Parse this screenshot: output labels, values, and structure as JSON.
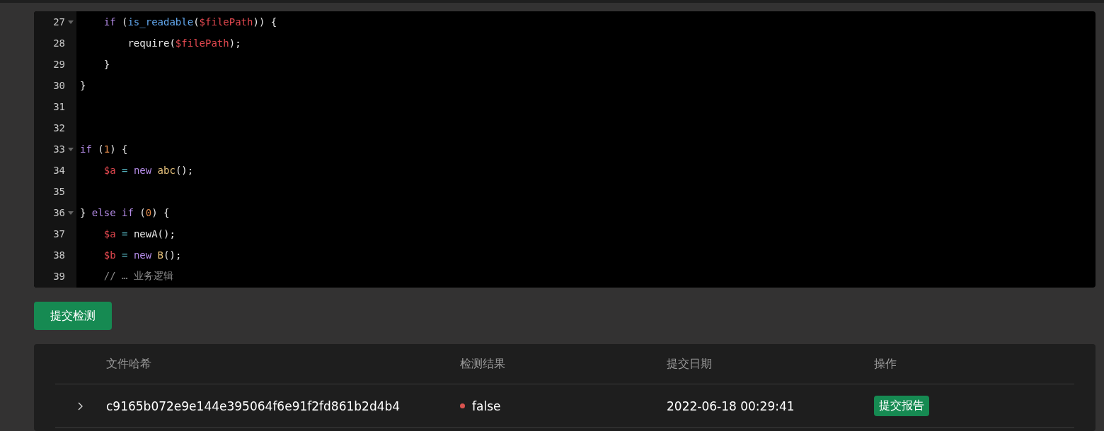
{
  "editor": {
    "lines": [
      {
        "number": "27",
        "foldable": true,
        "tokens": [
          {
            "kind": "keyword",
            "text": "    if"
          },
          {
            "kind": "plain",
            "text": " ("
          },
          {
            "kind": "function",
            "text": "is_readable"
          },
          {
            "kind": "plain",
            "text": "("
          },
          {
            "kind": "variable",
            "text": "$filePath"
          },
          {
            "kind": "plain",
            "text": ")) {"
          }
        ]
      },
      {
        "number": "28",
        "foldable": false,
        "tokens": [
          {
            "kind": "plain",
            "text": "        require("
          },
          {
            "kind": "variable",
            "text": "$filePath"
          },
          {
            "kind": "plain",
            "text": ");"
          }
        ]
      },
      {
        "number": "29",
        "foldable": false,
        "tokens": [
          {
            "kind": "plain",
            "text": "    }"
          }
        ]
      },
      {
        "number": "30",
        "foldable": false,
        "tokens": [
          {
            "kind": "plain",
            "text": "}"
          }
        ]
      },
      {
        "number": "31",
        "foldable": false
      },
      {
        "number": "32",
        "foldable": false
      },
      {
        "number": "33",
        "foldable": true,
        "tokens": [
          {
            "kind": "keyword",
            "text": "if"
          },
          {
            "kind": "plain",
            "text": " ("
          },
          {
            "kind": "number",
            "text": "1"
          },
          {
            "kind": "plain",
            "text": ") {"
          }
        ]
      },
      {
        "number": "34",
        "foldable": false,
        "tokens": [
          {
            "kind": "variable",
            "text": "    $a"
          },
          {
            "kind": "operator",
            "text": " = "
          },
          {
            "kind": "keyword",
            "text": "new"
          },
          {
            "kind": "class",
            "text": " abc"
          },
          {
            "kind": "plain",
            "text": "();"
          }
        ]
      },
      {
        "number": "35",
        "foldable": false
      },
      {
        "number": "36",
        "foldable": true,
        "tokens": [
          {
            "kind": "plain",
            "text": "} "
          },
          {
            "kind": "keyword",
            "text": "else if"
          },
          {
            "kind": "plain",
            "text": " ("
          },
          {
            "kind": "number",
            "text": "0"
          },
          {
            "kind": "plain",
            "text": ") {"
          }
        ]
      },
      {
        "number": "37",
        "foldable": false,
        "tokens": [
          {
            "kind": "variable",
            "text": "    $a"
          },
          {
            "kind": "operator",
            "text": " = "
          },
          {
            "kind": "plain",
            "text": "newA();"
          }
        ]
      },
      {
        "number": "38",
        "foldable": false,
        "tokens": [
          {
            "kind": "variable",
            "text": "    $b"
          },
          {
            "kind": "operator",
            "text": " = "
          },
          {
            "kind": "keyword",
            "text": "new"
          },
          {
            "kind": "class",
            "text": " B"
          },
          {
            "kind": "plain",
            "text": "();"
          }
        ]
      },
      {
        "number": "39",
        "foldable": false,
        "tokens": [
          {
            "kind": "comment",
            "text": "    // … 业务逻辑"
          }
        ]
      }
    ]
  },
  "submit_button": "提交检测",
  "table": {
    "columns": [
      "文件哈希",
      "检测结果",
      "提交日期",
      "操作"
    ],
    "rows": [
      {
        "expanded": false,
        "hash": "c9165b072e9e144e395064f6e91f2fd861b2d4b4",
        "result": "false",
        "color": "#d9534f",
        "date": "2022-06-18 00:29:41",
        "action": "提交报告"
      }
    ]
  }
}
